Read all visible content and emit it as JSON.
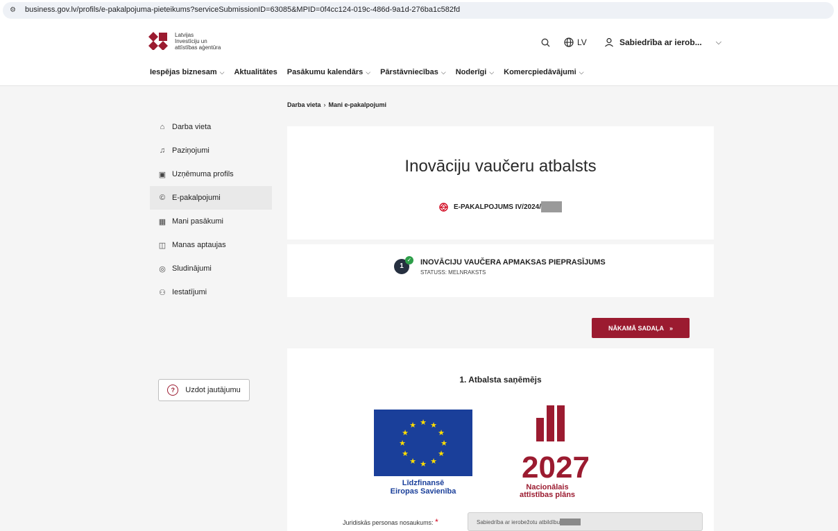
{
  "browser": {
    "url": "business.gov.lv/profils/e-pakalpojuma-pieteikums?serviceSubmissionID=63085&MPID=0f4cc124-019c-486d-9a1d-276ba1c582fd"
  },
  "header": {
    "logo_lines": [
      "Latvijas",
      "Investīciju un",
      "attīstības aģentūra"
    ],
    "language": "LV",
    "user_name": "Sabiedrība ar ierob..."
  },
  "nav": {
    "items": [
      {
        "label": "Iespējas biznesam",
        "dropdown": true
      },
      {
        "label": "Aktualitātes",
        "dropdown": false
      },
      {
        "label": "Pasākumu kalendārs",
        "dropdown": true
      },
      {
        "label": "Pārstāvniecības",
        "dropdown": true
      },
      {
        "label": "Noderīgi",
        "dropdown": true
      },
      {
        "label": "Komercpiedāvājumi",
        "dropdown": true
      }
    ]
  },
  "breadcrumb": {
    "items": [
      "Darba vieta",
      "Mani e-pakalpojumi"
    ]
  },
  "sidebar": {
    "items": [
      {
        "label": "Darba vieta",
        "icon": "home-icon"
      },
      {
        "label": "Paziņojumi",
        "icon": "bell-icon"
      },
      {
        "label": "Uzņēmuma profils",
        "icon": "briefcase-icon"
      },
      {
        "label": "E-pakalpojumi",
        "icon": "e-service-icon",
        "active": true
      },
      {
        "label": "Mani pasākumi",
        "icon": "calendar-icon"
      },
      {
        "label": "Manas aptaujas",
        "icon": "survey-icon"
      },
      {
        "label": "Sludinājumi",
        "icon": "search-list-icon"
      },
      {
        "label": "Iestatījumi",
        "icon": "settings-icon"
      }
    ],
    "ask_button": "Uzdot jautājumu"
  },
  "service": {
    "title": "Inovāciju vaučeru atbalsts",
    "reference": "E-PAKALPOJUMS IV/2024/"
  },
  "step": {
    "number": "1",
    "title": "INOVĀCIJU VAUČERA APMAKSAS PIEPRASĪJUMS",
    "status": "STATUSS: MELNRAKSTS"
  },
  "next_button": "NĀKAMĀ SADAĻA",
  "section": {
    "title": "1. Atbalsta saņēmējs",
    "eu_caption": [
      "Līdzfinansē",
      "Eiropas Savienība"
    ],
    "nap_year": "2027",
    "nap_caption": [
      "Nacionālais",
      "attīstības plāns"
    ],
    "field_label": "Juridiskās personas nosaukums:",
    "field_value": "Sabiedrība ar ierobežotu atbildību"
  },
  "colors": {
    "brand": "#9b1b30",
    "eu_blue": "#1a3f9a",
    "eu_star": "#ffde00",
    "status_ok": "#2e9e4a"
  }
}
